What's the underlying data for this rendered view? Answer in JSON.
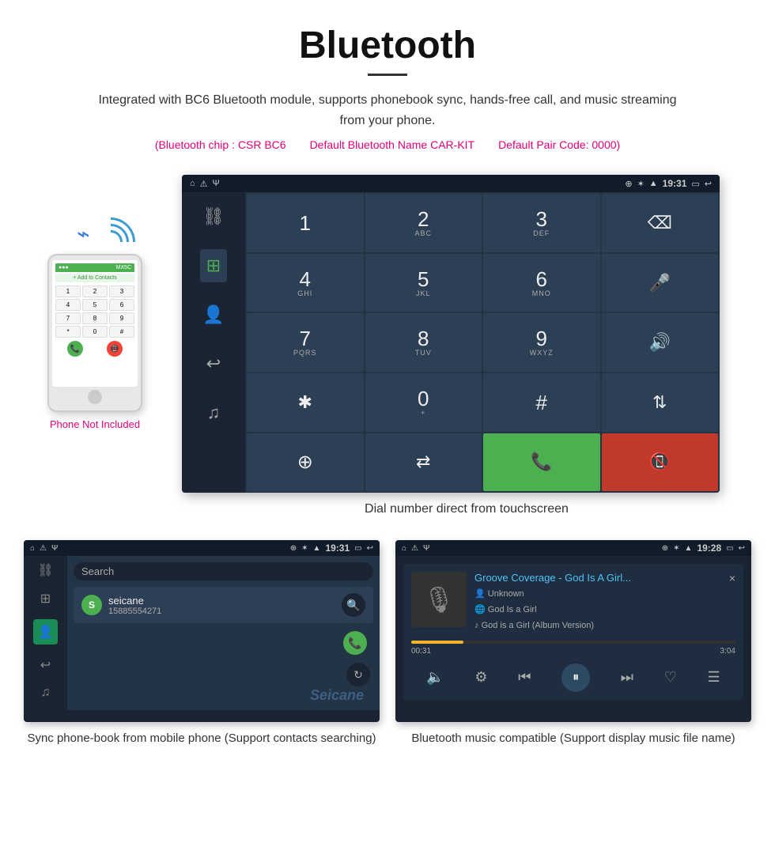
{
  "header": {
    "title": "Bluetooth",
    "description": "Integrated with BC6 Bluetooth module, supports phonebook sync, hands-free call, and music streaming from your phone.",
    "spec_chip": "(Bluetooth chip : CSR BC6",
    "spec_name": "Default Bluetooth Name CAR-KIT",
    "spec_code": "Default Pair Code: 0000)",
    "caption_dialer": "Dial number direct from touchscreen",
    "caption_phonebook": "Sync phone-book from mobile phone\n(Support contacts searching)",
    "caption_music": "Bluetooth music compatible\n(Support display music file name)"
  },
  "phone": {
    "not_included_label": "Phone Not Included"
  },
  "dialer_screen": {
    "status_time": "19:31",
    "keys": [
      {
        "digit": "1",
        "sub": ""
      },
      {
        "digit": "2",
        "sub": "ABC"
      },
      {
        "digit": "3",
        "sub": "DEF"
      },
      {
        "digit": "⌫",
        "sub": ""
      },
      {
        "digit": "4",
        "sub": "GHI"
      },
      {
        "digit": "5",
        "sub": "JKL"
      },
      {
        "digit": "6",
        "sub": "MNO"
      },
      {
        "digit": "🎤",
        "sub": ""
      },
      {
        "digit": "7",
        "sub": "PQRS"
      },
      {
        "digit": "8",
        "sub": "TUV"
      },
      {
        "digit": "9",
        "sub": "WXYZ"
      },
      {
        "digit": "🔊",
        "sub": ""
      },
      {
        "digit": "✱",
        "sub": ""
      },
      {
        "digit": "0",
        "sub": "+"
      },
      {
        "digit": "#",
        "sub": ""
      },
      {
        "digit": "⇅",
        "sub": ""
      }
    ],
    "bottom_row": [
      {
        "digit": "↑",
        "sub": ""
      },
      {
        "digit": "⇄",
        "sub": ""
      },
      {
        "digit": "📞",
        "type": "green"
      },
      {
        "digit": "📵",
        "type": "red"
      }
    ]
  },
  "phonebook_screen": {
    "status_time": "19:31",
    "search_placeholder": "Search",
    "contact": {
      "initial": "S",
      "name": "seicane",
      "number": "15885554271"
    },
    "watermark": "Seicane"
  },
  "music_screen": {
    "status_time": "19:28",
    "close_label": "×",
    "song_title": "Groove Coverage - God Is A Girl...",
    "artist": "Unknown",
    "album": "God Is a Girl",
    "track": "God is a Girl (Album Version)",
    "current_time": "00:31",
    "total_time": "3:04",
    "progress_percent": 16
  }
}
